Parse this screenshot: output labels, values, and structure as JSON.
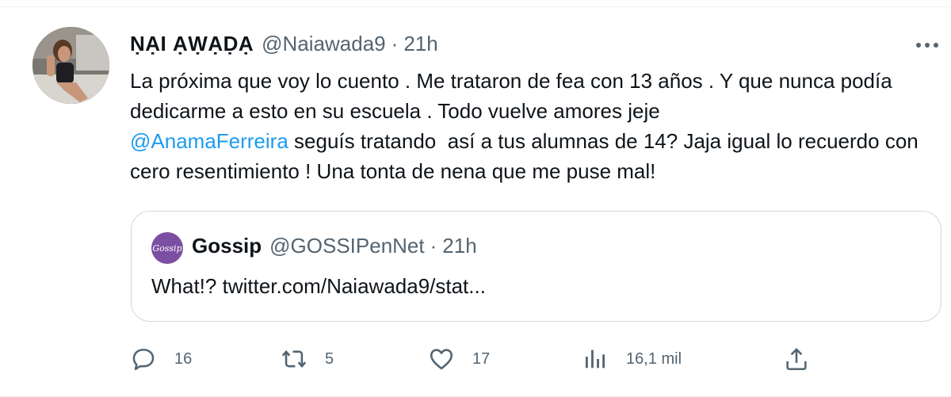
{
  "tweet": {
    "display_name": "ṆẠI ẠẈẠḌẠ",
    "handle": "@Naiawada9",
    "separator": "·",
    "time": "21h",
    "text_part1": "La próxima que voy lo cuento . Me trataron de fea con 13 años . Y que nunca podía dedicarme a esto en su escuela . Todo vuelve amores jeje\n",
    "mention": "@AnamaFerreira",
    "text_part2": " seguís tratando  así a tus alumnas de 14? Jaja igual lo recuerdo con cero resentimiento ! Una tonta de nena que me puse mal!"
  },
  "quote": {
    "avatar_text": "Gossip",
    "display_name": "Gossip",
    "handle": "@GOSSIPenNet",
    "separator": "·",
    "time": "21h",
    "text": "What!? twitter.com/Naiawada9/stat..."
  },
  "actions": {
    "reply_count": "16",
    "retweet_count": "5",
    "like_count": "17",
    "views_count": "16,1 mil"
  },
  "colors": {
    "accent": "#1d9bf0",
    "secondary_text": "#536471",
    "border": "#cfd9de",
    "quote_avatar_bg": "#7d4fa2"
  },
  "icons": [
    "more-icon",
    "reply-icon",
    "retweet-icon",
    "like-icon",
    "views-icon",
    "share-icon"
  ]
}
